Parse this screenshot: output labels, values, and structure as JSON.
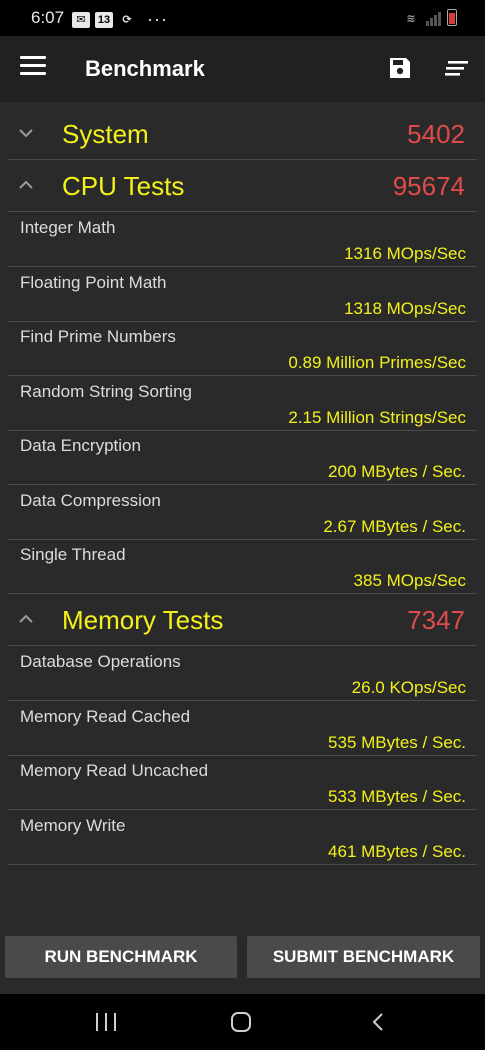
{
  "status_bar": {
    "time": "6:07",
    "icons": [
      "mail-icon",
      "calendar-icon",
      "sync-icon",
      "more-icon",
      "wifi-icon",
      "signal-icon",
      "battery-icon"
    ],
    "calendar_day": "13",
    "more": "···"
  },
  "app_bar": {
    "title": "Benchmark",
    "icons": [
      "menu-icon",
      "save-icon",
      "sort-icon"
    ]
  },
  "sections": [
    {
      "name": "System",
      "score": "5402",
      "expanded": false
    },
    {
      "name": "CPU Tests",
      "score": "95674",
      "expanded": true
    },
    {
      "name": "Memory Tests",
      "score": "7347",
      "expanded": true
    }
  ],
  "cpu_tests": [
    {
      "label": "Integer Math",
      "value": "1316 MOps/Sec"
    },
    {
      "label": "Floating Point Math",
      "value": "1318 MOps/Sec"
    },
    {
      "label": "Find Prime Numbers",
      "value": "0.89 Million Primes/Sec"
    },
    {
      "label": "Random String Sorting",
      "value": "2.15 Million Strings/Sec"
    },
    {
      "label": "Data Encryption",
      "value": "200 MBytes / Sec."
    },
    {
      "label": "Data Compression",
      "value": "2.67 MBytes / Sec."
    },
    {
      "label": "Single Thread",
      "value": "385 MOps/Sec"
    }
  ],
  "memory_tests": [
    {
      "label": "Database Operations",
      "value": "26.0 KOps/Sec"
    },
    {
      "label": "Memory Read Cached",
      "value": "535 MBytes / Sec."
    },
    {
      "label": "Memory Read Uncached",
      "value": "533 MBytes / Sec."
    },
    {
      "label": "Memory Write",
      "value": "461 MBytes / Sec."
    }
  ],
  "buttons": {
    "run": "RUN BENCHMARK",
    "submit": "SUBMIT BENCHMARK"
  },
  "colors": {
    "accent_yellow": "#f3f11a",
    "score_red": "#e04b4b",
    "background": "#2a2a2a",
    "app_bar": "#212121"
  }
}
